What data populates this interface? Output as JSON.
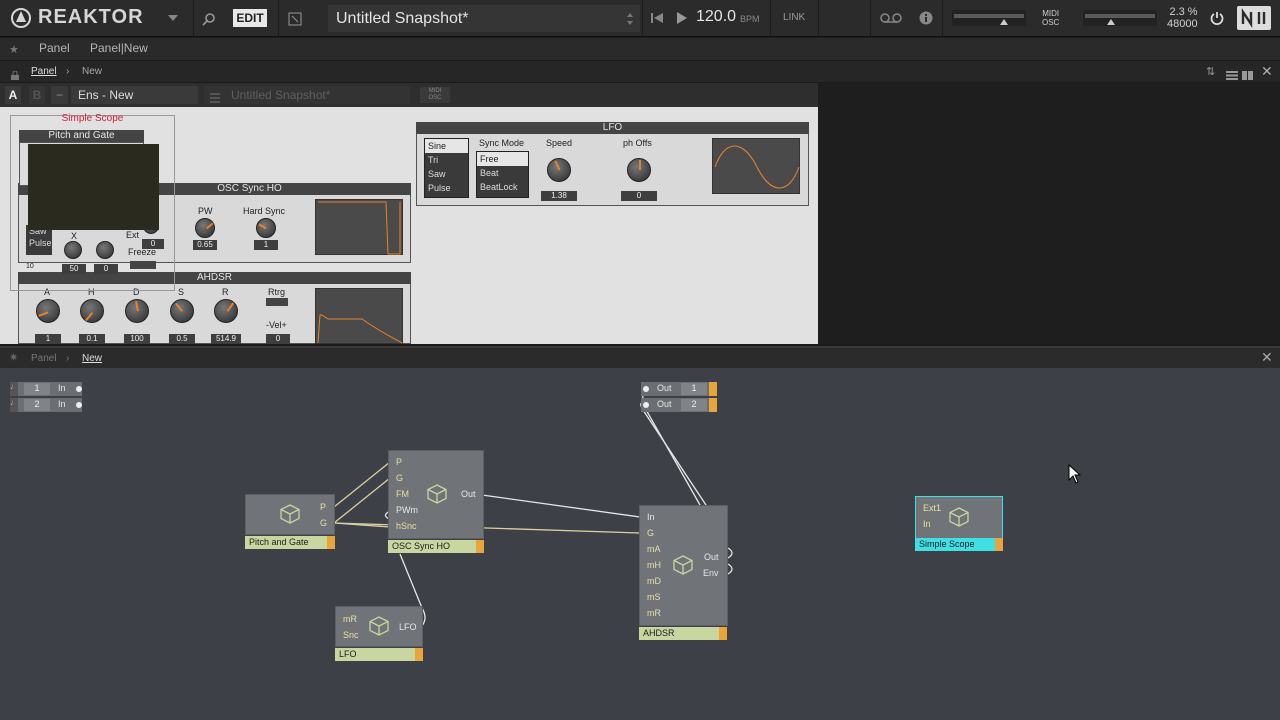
{
  "app": {
    "logo_text": "REAKTOR",
    "edit_label": "EDIT",
    "snapshot_title": "Untitled Snapshot*",
    "tempo": "120.0",
    "tempo_unit": "BPM",
    "link_label": "LINK",
    "midi_osc_top": "MIDI",
    "midi_osc_bottom": "OSC",
    "cpu_percent": "2.3 %",
    "sample_rate": "48000"
  },
  "toolbar2": {
    "panel_label": "Panel",
    "panel_new_label": "Panel|New"
  },
  "breadcrumb_top": {
    "items": [
      "Panel",
      "New"
    ]
  },
  "panel_toolbar": {
    "a_label": "A",
    "b_label": "B",
    "ensemble_name": "Ens - New",
    "snapshot_placeholder": "Untitled Snapshot*",
    "midi_top": "MIDI",
    "midi_bottom": "OSC"
  },
  "panel": {
    "simple_scope_title": "Simple Scope",
    "pitch_gate_title": "Pitch and Gate",
    "osc_title": "OSC Sync HO",
    "osc_pw_label": "PW",
    "osc_pw_value": "0.65",
    "osc_hard_sync_label": "Hard Sync",
    "osc_hard_sync_value": "1",
    "osc_ext_label": "Ext",
    "osc_ext_value": "0",
    "osc_freeze_label": "Freeze",
    "osc_x_label": "X",
    "osc_val_50": "50",
    "osc_val_0": "0",
    "osc_num_10": "10",
    "osc_saw_label": "Saw",
    "osc_pulse_label": "Pulse",
    "lfo_title": "LFO",
    "lfo_waves": [
      "Sine",
      "Tri",
      "Saw",
      "Pulse"
    ],
    "lfo_sync_mode_label": "Sync Mode",
    "lfo_sync_modes": [
      "Free",
      "Beat",
      "BeatLock"
    ],
    "lfo_speed_label": "Speed",
    "lfo_speed_value": "1.38",
    "lfo_phoffs_label": "ph Offs",
    "lfo_phoffs_value": "0",
    "ahdsr_title": "AHDSR",
    "ahdsr_knobs": [
      {
        "label": "A",
        "value": "1"
      },
      {
        "label": "H",
        "value": "0.1"
      },
      {
        "label": "D",
        "value": "100"
      },
      {
        "label": "S",
        "value": "0.5"
      },
      {
        "label": "R",
        "value": "514.9"
      }
    ],
    "ahdsr_rtrg_label": "Rtrg",
    "ahdsr_vel_label": "-Vel+",
    "ahdsr_vel_value": "0"
  },
  "structure_bar": {
    "items": [
      "Panel",
      "New"
    ]
  },
  "structure": {
    "inputs": [
      {
        "num": "1",
        "label": "In"
      },
      {
        "num": "2",
        "label": "In"
      }
    ],
    "outputs": [
      {
        "num": "1",
        "label": "Out"
      },
      {
        "num": "2",
        "label": "Out"
      }
    ],
    "blocks": {
      "pitch_gate": {
        "name": "Pitch and Gate",
        "outs": [
          "P",
          "G"
        ]
      },
      "osc": {
        "name": "OSC Sync HO",
        "ins": [
          "P",
          "G",
          "FM",
          "PWm",
          "hSnc"
        ],
        "outs": [
          "Out"
        ]
      },
      "lfo": {
        "name": "LFO",
        "ins": [
          "mR",
          "Snc"
        ],
        "outs": [
          "LFO"
        ]
      },
      "ahdsr": {
        "name": "AHDSR",
        "ins": [
          "In",
          "G",
          "mA",
          "mH",
          "mD",
          "mS",
          "mR"
        ],
        "outs": [
          "Out",
          "Env"
        ]
      },
      "scope": {
        "name": "Simple Scope",
        "ins": [
          "Ext1",
          "In"
        ]
      }
    }
  },
  "colors": {
    "accent_orange": "#e8822a",
    "block_name_bg": "#c8d6a0",
    "scope_cyan": "#3ee0e6",
    "structure_bg": "#3d4147",
    "simple_scope_red": "#d0203a"
  }
}
